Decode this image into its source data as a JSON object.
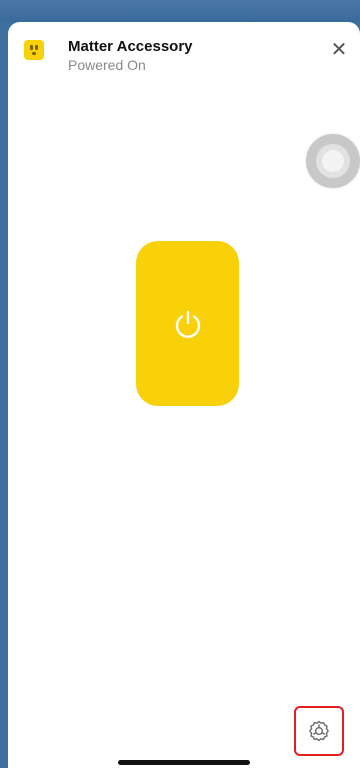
{
  "header": {
    "title": "Matter Accessory",
    "subtitle": "Powered On",
    "close_label": "✕"
  },
  "icons": {
    "accessory": "outlet-icon",
    "power": "power-icon",
    "settings": "gear-icon",
    "close": "close-icon"
  },
  "power": {
    "state": "on"
  },
  "colors": {
    "accent": "#f9d10a",
    "highlight_border": "#e0201f",
    "backdrop": "#3f6f9f"
  }
}
